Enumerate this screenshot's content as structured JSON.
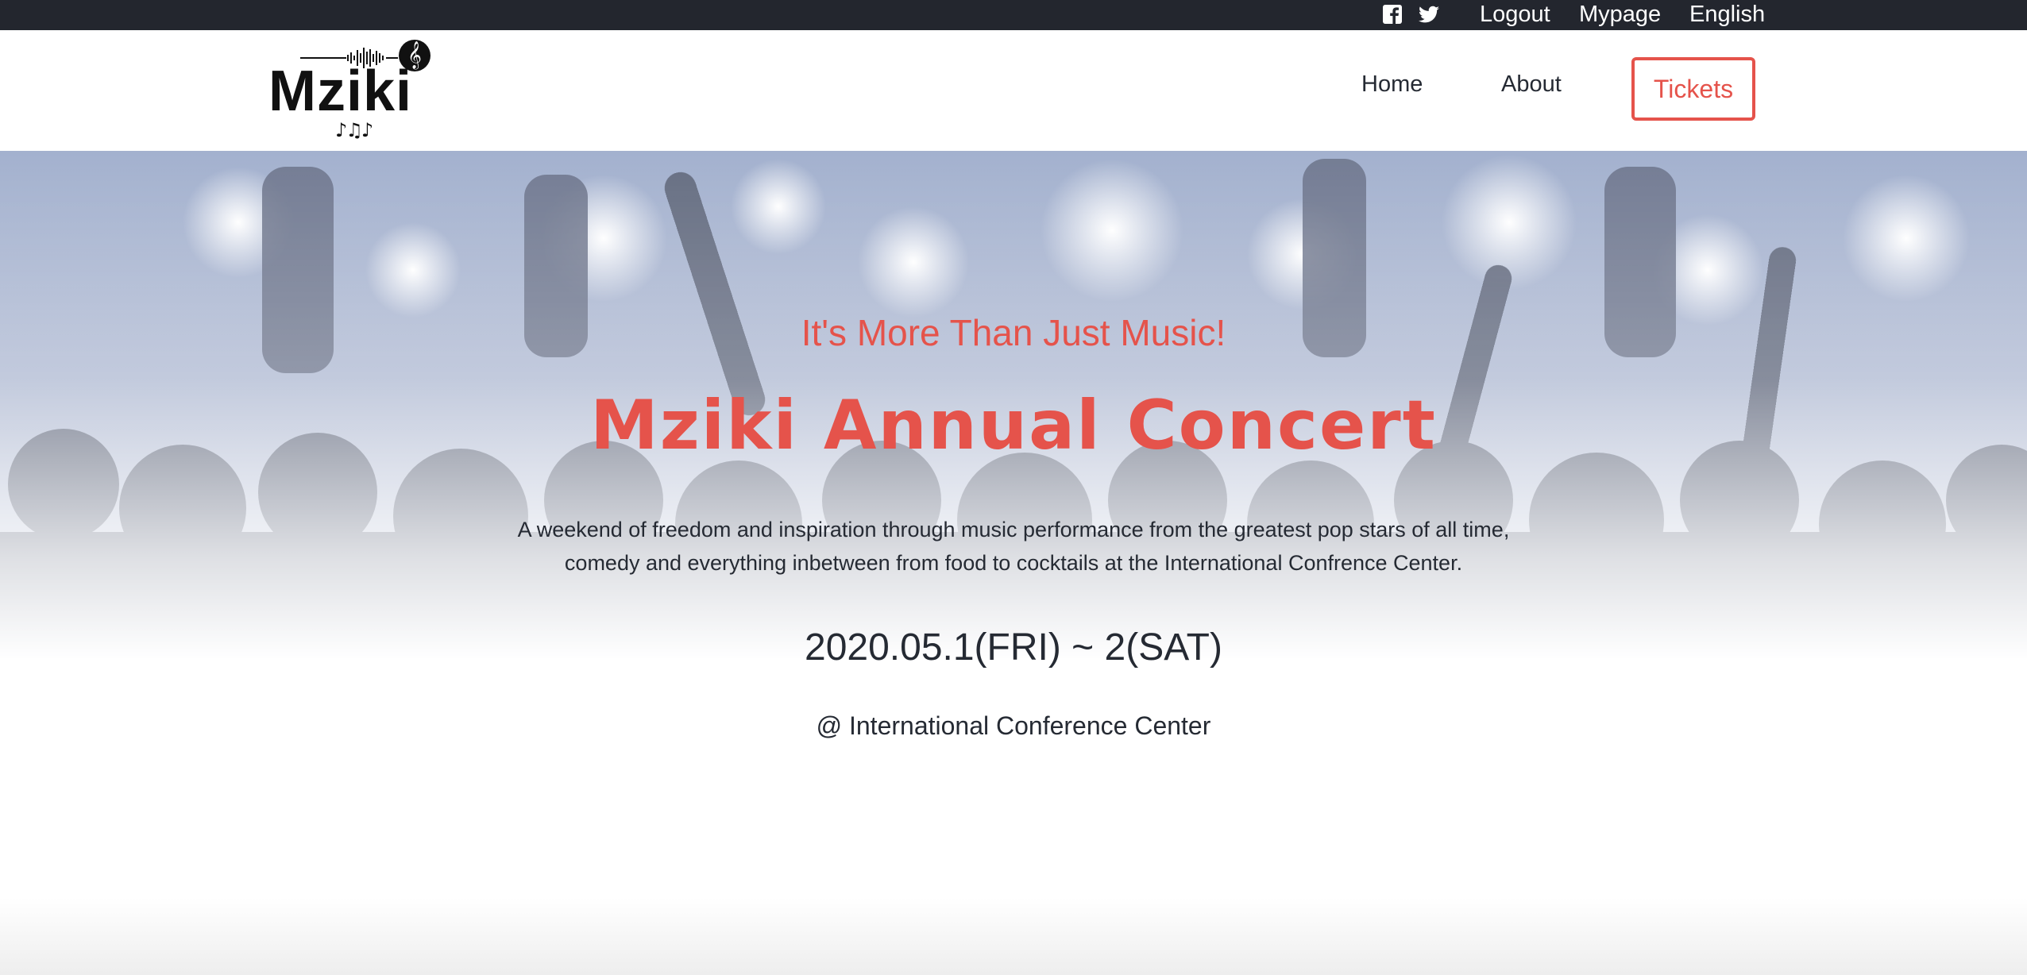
{
  "topbar": {
    "icons": [
      "facebook-icon",
      "twitter-icon"
    ],
    "links": {
      "logout": "Logout",
      "mypage": "Mypage",
      "language": "English"
    }
  },
  "header": {
    "logo_text": "Mziki",
    "nav": {
      "home": "Home",
      "about": "About",
      "tickets": "Tickets"
    }
  },
  "hero": {
    "tagline": "It's More Than Just Music!",
    "title": "Mziki Annual Concert",
    "description": "A weekend of freedom and inspiration through music performance from the greatest pop stars of all time, comedy and everything inbetween from food to cocktails at the International Confrence Center.",
    "date": "2020.05.1(FRI) ~ 2(SAT)",
    "venue": "@ International Conference Center"
  },
  "colors": {
    "accent": "#e5534b",
    "topbar_bg": "#23262e",
    "text": "#252a33"
  }
}
